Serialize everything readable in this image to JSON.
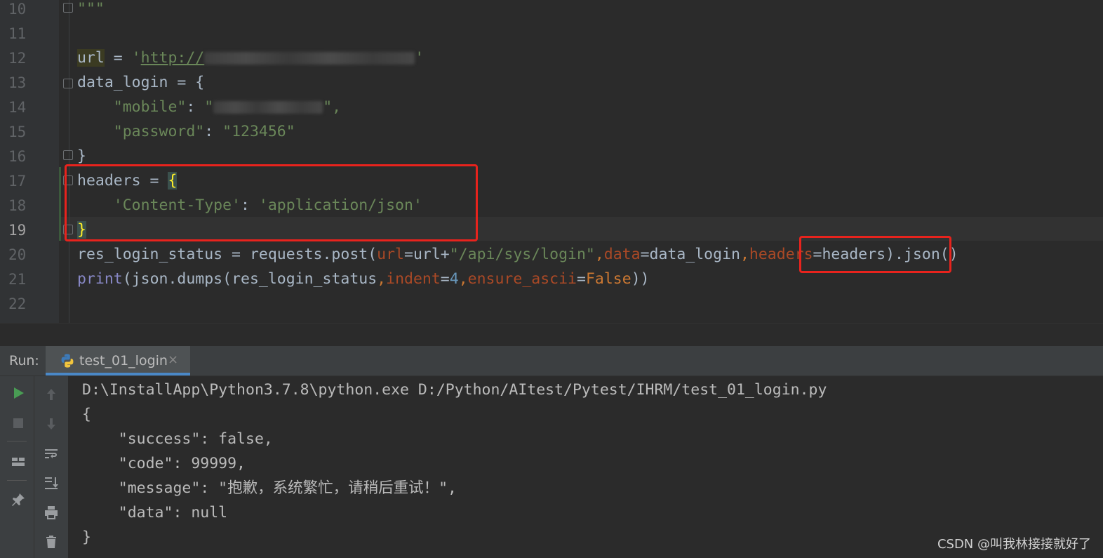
{
  "editor": {
    "line_numbers": [
      "10",
      "11",
      "12",
      "13",
      "14",
      "15",
      "16",
      "17",
      "18",
      "19",
      "20",
      "21",
      "22"
    ],
    "lines": {
      "l10": "\"\"\"",
      "l12_var": "url",
      "l12_eq": " = ",
      "l12_q1": "'",
      "l12_url": "http://",
      "l12_q2": "'",
      "l13": "data_login = {",
      "l14_key": "\"mobile\"",
      "l14_colon": ": ",
      "l14_q1": "\"",
      "l14_q2": "\",",
      "l15_key": "\"password\"",
      "l15_colon": ": ",
      "l15_val": "\"123456\"",
      "l16": "}",
      "l17_var": "headers = ",
      "l17_brace": "{",
      "l18_key": "'Content-Type'",
      "l18_colon": ": ",
      "l18_val": "'application/json'",
      "l19_brace": "}",
      "l20_a": "res_login_status = requests.post(",
      "l20_p1": "url",
      "l20_b": "=url+",
      "l20_s": "\"/api/sys/login\"",
      "l20_c1": ",",
      "l20_p2": "data",
      "l20_d": "=data_login",
      "l20_c2": ",",
      "l20_p3": "headers",
      "l20_e": "=headers",
      "l20_f": ").json()",
      "l21_print": "print",
      "l21_a": "(json.dumps(res_login_status",
      "l21_c1": ",",
      "l21_p1": "indent",
      "l21_eq1": "=",
      "l21_num": "4",
      "l21_c2": ",",
      "l21_p2": "ensure_ascii",
      "l21_eq2": "=",
      "l21_kw": "False",
      "l21_end": "))"
    }
  },
  "run_panel": {
    "label": "Run:",
    "tab_name": "test_01_login",
    "tab_close": "×",
    "output": [
      "D:\\InstallApp\\Python3.7.8\\python.exe D:/Python/AItest/Pytest/IHRM/test_01_login.py",
      "{",
      "    \"success\": false,",
      "    \"code\": 99999,",
      "    \"message\": \"抱歉，系统繁忙，请稍后重试！\",",
      "    \"data\": null",
      "}"
    ]
  },
  "watermark": "CSDN @叫我林接接就好了",
  "colors": {
    "annotation_red": "#e8231d",
    "keyword_orange": "#cc7832",
    "string_green": "#6a8759",
    "number_blue": "#6897bb"
  },
  "icons": [
    "run-icon",
    "stop-icon",
    "layout-icon",
    "pin-icon",
    "scroll-up-icon",
    "scroll-down-icon",
    "soft-wrap-icon",
    "scroll-to-end-icon",
    "print-icon",
    "trash-icon",
    "python-icon",
    "close-icon",
    "fold-icon"
  ]
}
